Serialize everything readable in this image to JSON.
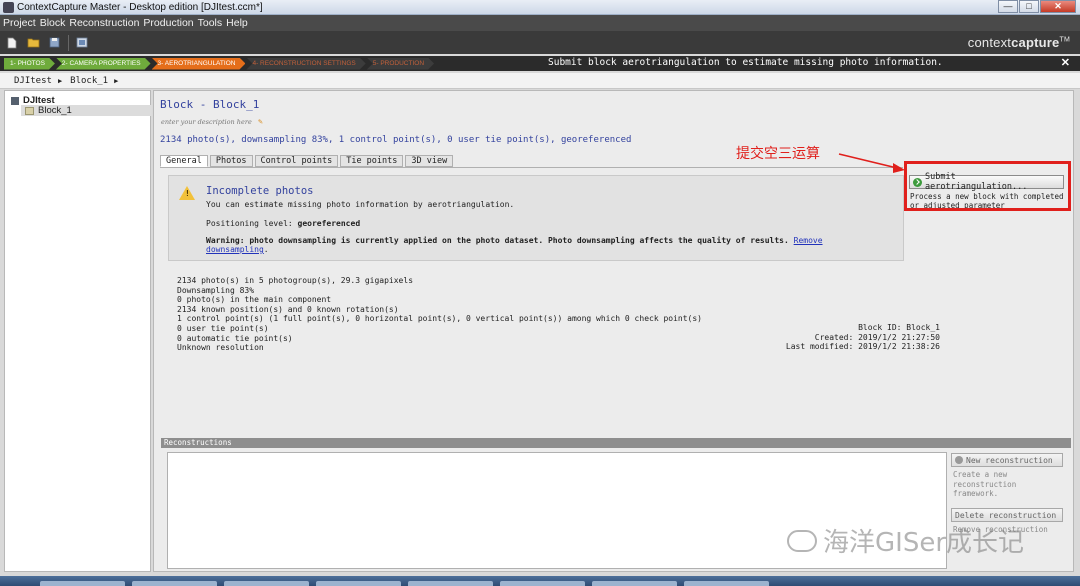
{
  "window": {
    "title": "ContextCapture Master - Desktop edition [DJItest.ccm*]",
    "controls": [
      "—",
      "□",
      "✕"
    ]
  },
  "menu": [
    "Project",
    "Block",
    "Reconstruction",
    "Production",
    "Tools",
    "Help"
  ],
  "toolbar": {
    "icons": [
      "new-file-icon",
      "open-folder-icon",
      "save-icon",
      "screenshot-icon"
    ],
    "brand_regular": "context",
    "brand_bold": "capture",
    "brand_tm": "TM"
  },
  "steps": [
    {
      "label": "1- PHOTOS",
      "state": "done"
    },
    {
      "label": "2- CAMERA PROPERTIES",
      "state": "done"
    },
    {
      "label": "3- AEROTRIANGULATION",
      "state": "active"
    },
    {
      "label": "4- RECONSTRUCTION SETTINGS",
      "state": "todo"
    },
    {
      "label": "5- PRODUCTION",
      "state": "todo"
    }
  ],
  "step_hint": "Submit block aerotriangulation to estimate missing photo information.",
  "breadcrumb": [
    "DJItest",
    "Block_1"
  ],
  "tree": {
    "project": "DJItest",
    "block": "Block_1"
  },
  "block": {
    "title": "Block - Block_1",
    "description_placeholder": "enter your description here",
    "summary": "2134 photo(s), downsampling 83%, 1 control point(s), 0 user tie point(s), georeferenced"
  },
  "tabs": [
    "General",
    "Photos",
    "Control points",
    "Tie points",
    "3D view"
  ],
  "notice": {
    "title": "Incomplete photos",
    "line1": "You can estimate missing photo information by aerotriangulation.",
    "positioning_label": "Positioning level: ",
    "positioning_value": "georeferenced",
    "warning_bold": "Warning: photo downsampling is currently applied on the photo dataset. Photo downsampling affects the quality of results.",
    "warning_link": "Remove downsampling",
    "warning_end": "."
  },
  "stats": [
    "2134 photo(s) in 5 photogroup(s), 29.3 gigapixels",
    "Downsampling 83%",
    "0 photo(s) in the main component",
    "2134 known position(s) and 0 known rotation(s)",
    "1 control point(s) (1 full point(s), 0 horizontal point(s), 0 vertical point(s)) among which 0 check point(s)",
    "0 user tie point(s)",
    "0 automatic tie point(s)",
    "Unknown resolution"
  ],
  "meta": {
    "block_id": "Block ID: Block_1",
    "created": "Created: 2019/1/2 21:27:50",
    "modified": "Last modified: 2019/1/2 21:38:26"
  },
  "submit": {
    "label": "Submit aerotriangulation...",
    "desc": "Process a new block with completed or adjusted parameter"
  },
  "annotation": {
    "text": "提交空三运算",
    "color": "#e0201c"
  },
  "reconstructions": {
    "header": "Reconstructions",
    "new_label": "New reconstruction",
    "new_desc": "Create a new reconstruction framework.",
    "remove_label": "Delete reconstruction",
    "remove_desc": "Remove reconstruction"
  },
  "watermark": "海洋GISer成长记",
  "colors": {
    "step_done": "#6fab3c",
    "step_active": "#e56e1a",
    "link_blue": "#33429e"
  }
}
